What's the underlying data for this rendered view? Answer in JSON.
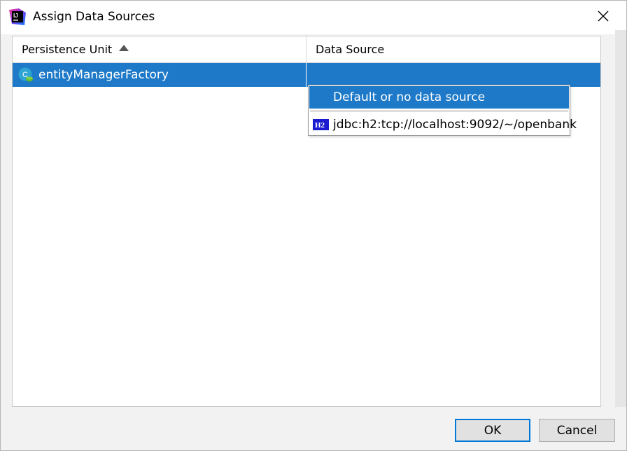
{
  "window": {
    "title": "Assign Data Sources",
    "app_icon": "intellij-idea-icon",
    "close_icon": "close-icon"
  },
  "table": {
    "columns": [
      {
        "label": "Persistence Unit",
        "sort": "ascending"
      },
      {
        "label": "Data Source"
      }
    ],
    "rows": [
      {
        "persistence_unit": "entityManagerFactory",
        "icon": "persistence-unit-icon",
        "data_source": "",
        "selected": true
      }
    ]
  },
  "dropdown": {
    "options": [
      {
        "label": "Default or no data source",
        "selected": true
      },
      {
        "label": "jdbc:h2:tcp://localhost:9092/~/openbank",
        "icon": "h2-icon",
        "icon_text": "H2"
      }
    ]
  },
  "buttons": {
    "ok": "OK",
    "cancel": "Cancel"
  },
  "colors": {
    "selection": "#1e7ac8",
    "ok_focus_border": "#0078d7",
    "h2_icon_bg": "#1a1ad0"
  }
}
